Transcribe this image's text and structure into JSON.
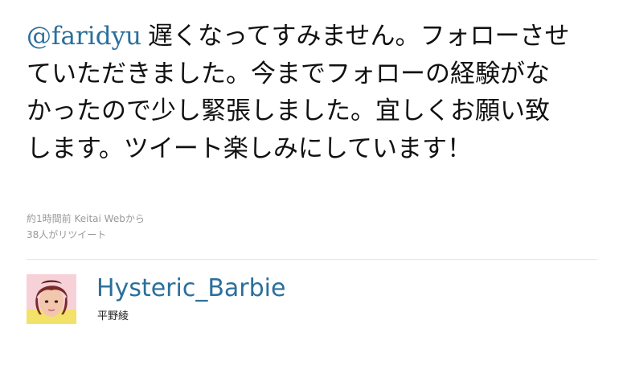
{
  "tweet": {
    "mention": "@faridyu",
    "text": "遅くなってすみません。フォローさせていただきました。今までフォローの経験がなかったので少し緊張しました。宜しくお願い致します。ツイート楽しみにしています！"
  },
  "meta": {
    "timestamp": "約1時間前",
    "source_prefix": "",
    "source": "Keitai Web",
    "source_suffix": "から",
    "retweets": "38人がリツイート"
  },
  "user": {
    "screen_name": "Hysteric_Barbie",
    "full_name": "平野綾"
  },
  "colors": {
    "link": "#2b6f9c",
    "meta_text": "#999999",
    "divider": "#e6e6e6"
  }
}
